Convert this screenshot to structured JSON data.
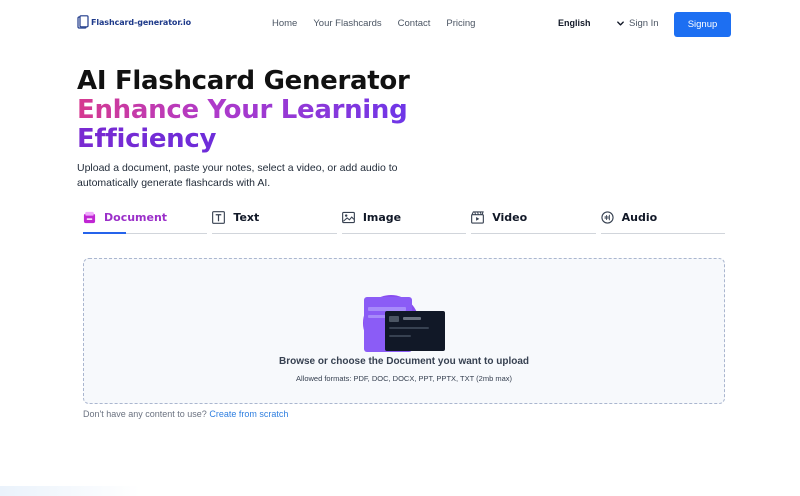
{
  "nav": {
    "logo_text": "Flashcard-generator.io",
    "links": [
      "Home",
      "Your Flashcards",
      "Contact",
      "Pricing"
    ],
    "language": "English",
    "signin": "Sign In",
    "signup": "Signup"
  },
  "hero": {
    "title_line1": "AI Flashcard Generator",
    "title_line2": "Enhance Your Learning",
    "title_line3": "Efficiency",
    "subtitle": "Upload a document, paste your notes, select a video, or add audio to automatically generate flashcards with AI."
  },
  "tabs": [
    {
      "label": "Document",
      "icon": "document-icon",
      "active": true
    },
    {
      "label": "Text",
      "icon": "text-icon",
      "active": false
    },
    {
      "label": "Image",
      "icon": "image-icon",
      "active": false
    },
    {
      "label": "Video",
      "icon": "video-icon",
      "active": false
    },
    {
      "label": "Audio",
      "icon": "audio-icon",
      "active": false
    }
  ],
  "upload": {
    "title": "Browse or choose the Document you want to upload",
    "formats": "Allowed formats: PDF, DOC, DOCX, PPT, PPTX, TXT (2mb max)"
  },
  "scratch": {
    "prompt": "Don't have any content to use?",
    "link": "Create from scratch"
  },
  "colors": {
    "accent": "#1d6ff2",
    "active_tab": "#9b2fc9",
    "gradient_start": "#d63a8f",
    "gradient_end": "#5b31e6"
  }
}
